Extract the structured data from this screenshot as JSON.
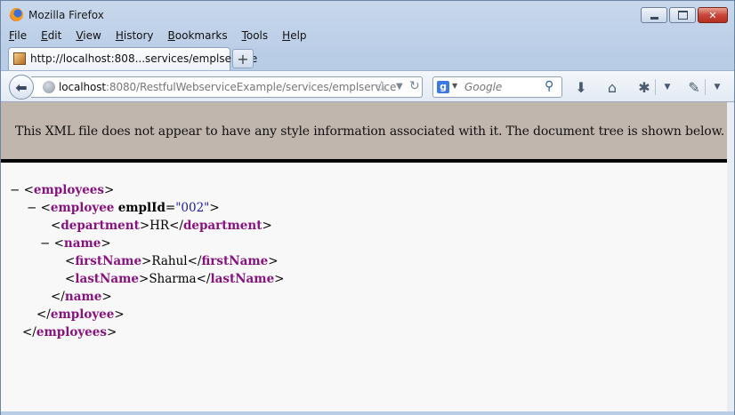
{
  "window": {
    "title": "Mozilla Firefox",
    "buttons": {
      "minimize": "",
      "maximize": "",
      "close": "✕"
    }
  },
  "menu": [
    "File",
    "Edit",
    "View",
    "History",
    "Bookmarks",
    "Tools",
    "Help"
  ],
  "tab": {
    "title": "http://localhost:808...services/emplservice",
    "new_tab": "+"
  },
  "nav": {
    "url_host": "localhost",
    "url_rest": ":8080/RestfulWebserviceExample/services/emplservice",
    "search_placeholder": "Google",
    "search_engine_letter": "g"
  },
  "banner": "This XML file does not appear to have any style information associated with it. The document tree is shown below.",
  "xml": {
    "toggle": "−",
    "lt": "<",
    "gt": ">",
    "close_lt": "</",
    "root": "employees",
    "employee": "employee",
    "attr_name": "emplId",
    "attr_value": "\"002\"",
    "department_tag": "department",
    "department_value": "HR",
    "name_tag": "name",
    "first_tag": "firstName",
    "first_value": "Rahul",
    "last_tag": "lastName",
    "last_value": "Sharma"
  }
}
